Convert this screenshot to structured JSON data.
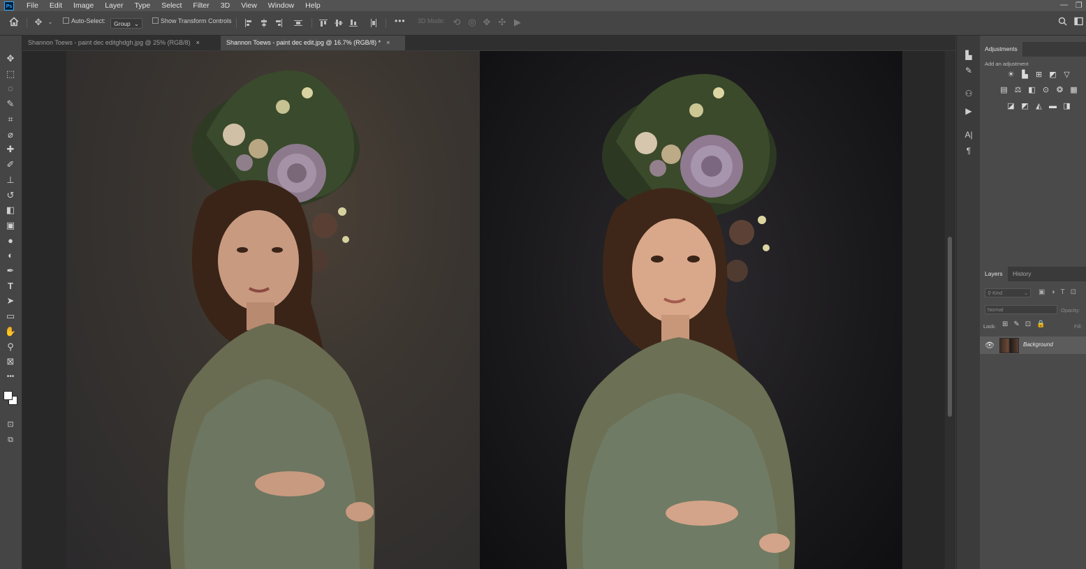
{
  "app": {
    "logo_text": "Ps",
    "menu": [
      "File",
      "Edit",
      "Image",
      "Layer",
      "Type",
      "Select",
      "Filter",
      "3D",
      "View",
      "Window",
      "Help"
    ],
    "window_controls": {
      "minimize": "—",
      "restore": "❐"
    }
  },
  "options_bar": {
    "auto_select_label": "Auto-Select:",
    "auto_select_target": "Group",
    "show_transform_label": "Show Transform Controls",
    "more_label": "•••",
    "mode_3d_label": "3D Mode:"
  },
  "tabs": [
    {
      "label": "Shannon Toews - paint dec editghdgh.jpg @ 25% (RGB/8)",
      "close": "×"
    },
    {
      "label": "Shannon Toews - paint dec edit.jpg @ 16.7% (RGB/8) *",
      "close": "×"
    }
  ],
  "toolbar": {
    "tools": [
      {
        "name": "move-tool",
        "glyph": "✥"
      },
      {
        "name": "marquee-tool",
        "glyph": "⬚"
      },
      {
        "name": "lasso-tool",
        "glyph": "◌"
      },
      {
        "name": "quick-select-tool",
        "glyph": "✎"
      },
      {
        "name": "crop-tool",
        "glyph": "⌗"
      },
      {
        "name": "eyedropper-tool",
        "glyph": "⌀"
      },
      {
        "name": "healing-brush-tool",
        "glyph": "✚"
      },
      {
        "name": "brush-tool",
        "glyph": "✐"
      },
      {
        "name": "clone-stamp-tool",
        "glyph": "⊥"
      },
      {
        "name": "history-brush-tool",
        "glyph": "↺"
      },
      {
        "name": "eraser-tool",
        "glyph": "◧"
      },
      {
        "name": "gradient-tool",
        "glyph": "▣"
      },
      {
        "name": "blur-tool",
        "glyph": "●"
      },
      {
        "name": "dodge-tool",
        "glyph": "◐"
      },
      {
        "name": "pen-tool",
        "glyph": "✒"
      },
      {
        "name": "type-tool",
        "glyph": "T"
      },
      {
        "name": "path-select-tool",
        "glyph": "➤"
      },
      {
        "name": "shape-tool",
        "glyph": "▭"
      },
      {
        "name": "hand-tool",
        "glyph": "✋"
      },
      {
        "name": "zoom-tool",
        "glyph": "⚲"
      },
      {
        "name": "frame-tool",
        "glyph": "⊠"
      },
      {
        "name": "more-tools",
        "glyph": "•••"
      }
    ],
    "foreground_color": "#ffffff",
    "background_color": "#ffffff"
  },
  "right_strip": {
    "icons": [
      {
        "name": "histogram-icon",
        "glyph": "▙"
      },
      {
        "name": "brush-settings-icon",
        "glyph": "✎"
      },
      {
        "name": "clone-source-icon",
        "glyph": "⚇"
      },
      {
        "name": "actions-play-icon",
        "glyph": "▶"
      },
      {
        "name": "character-icon",
        "glyph": "A|"
      },
      {
        "name": "paragraph-icon",
        "glyph": "¶"
      }
    ]
  },
  "adjustments_panel": {
    "title": "Adjustments",
    "add_label": "Add an adjustment",
    "rows": [
      [
        "brightness-contrast-icon",
        "levels-icon",
        "curves-icon",
        "exposure-icon",
        "vibrance-icon"
      ],
      [
        "hue-saturation-icon",
        "color-balance-icon",
        "black-white-icon",
        "photo-filter-icon",
        "channel-mixer-icon",
        "color-lookup-icon"
      ],
      [
        "invert-icon",
        "posterize-icon",
        "threshold-icon",
        "gradient-map-icon",
        "selective-color-icon"
      ]
    ]
  },
  "layers_panel": {
    "tabs": [
      "Layers",
      "History"
    ],
    "kind_placeholder": "Kind",
    "blend_mode": "Normal",
    "opacity_label": "Opacity:",
    "lock_label": "Lock:",
    "fill_label": "Fill:",
    "layer_name": "Background"
  },
  "colors": {
    "menubar": "#535353",
    "panel": "#4a4a4a",
    "canvas_bg": "#282828",
    "accent": "#31a8ff"
  }
}
